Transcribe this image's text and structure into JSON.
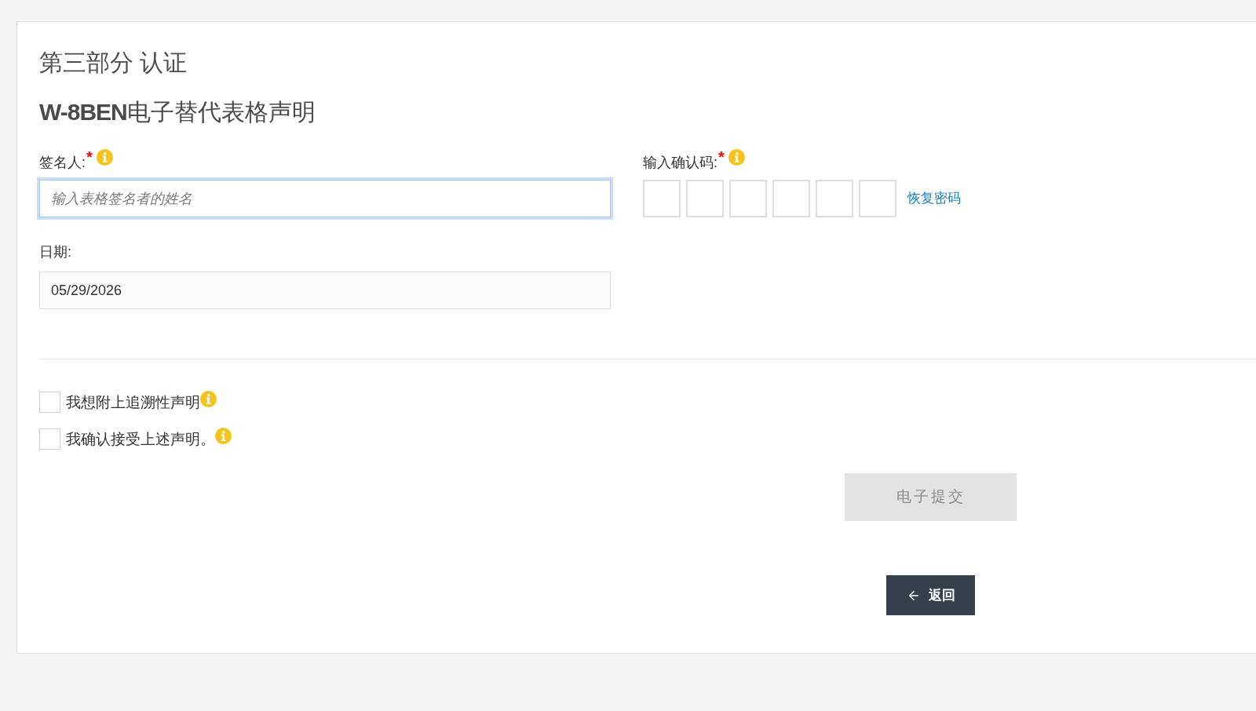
{
  "section_title": "第三部分 认证",
  "form_title": "**W-8BEN**电子替代表格声明",
  "signer": {
    "label": "签名人:",
    "required_mark": "*",
    "info": true,
    "placeholder": "输入表格签名者的姓名",
    "focused": true
  },
  "confirmation_code": {
    "label": "输入确认码:",
    "required_mark": "*",
    "info": true,
    "boxes": [
      {
        "filled": false
      },
      {
        "filled": false
      },
      {
        "filled": false
      },
      {
        "filled": false
      },
      {
        "filled": false
      },
      {
        "filled": false
      }
    ],
    "recover_link": "恢复密码"
  },
  "date": {
    "label": "日期:",
    "value": "05/29/2026"
  },
  "checkboxes": [
    {
      "label": "我想附上追溯性声明",
      "checked": false,
      "info": true
    },
    {
      "label": "我确认接受上述声明。",
      "checked": false,
      "info": true
    }
  ],
  "submit_button": {
    "label": "电子提交",
    "disabled": true
  },
  "back_button": {
    "label": "返回"
  }
}
